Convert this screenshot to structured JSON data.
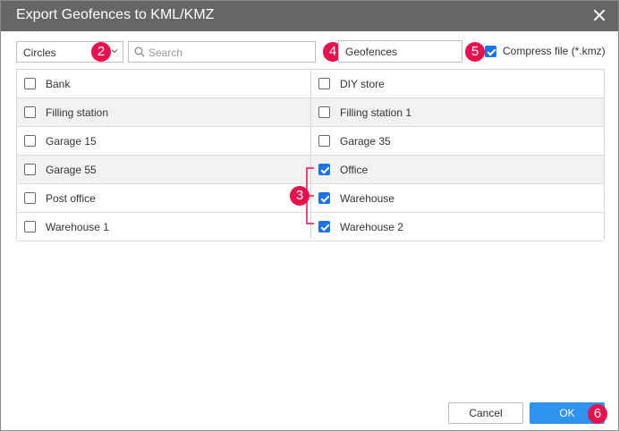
{
  "window": {
    "title": "Export Geofences to KML/KMZ"
  },
  "toolbar": {
    "type_select_value": "Circles",
    "search_placeholder": "Search",
    "filename_value": "Geofences",
    "compress_label": "Compress file (*.kmz)",
    "compress_checked": true
  },
  "geofences": {
    "left": [
      {
        "label": "Bank",
        "checked": false
      },
      {
        "label": "Filling station",
        "checked": false
      },
      {
        "label": "Garage 15",
        "checked": false
      },
      {
        "label": "Garage 55",
        "checked": false
      },
      {
        "label": "Post office",
        "checked": false
      },
      {
        "label": "Warehouse 1",
        "checked": false
      }
    ],
    "right": [
      {
        "label": "DIY store",
        "checked": false
      },
      {
        "label": "Filling station 1",
        "checked": false
      },
      {
        "label": "Garage 35",
        "checked": false
      },
      {
        "label": "Office",
        "checked": true
      },
      {
        "label": "Warehouse",
        "checked": true
      },
      {
        "label": "Warehouse 2",
        "checked": true
      }
    ]
  },
  "annotations": {
    "b2": "2",
    "b3": "3",
    "b4": "4",
    "b5": "5",
    "b6": "6"
  },
  "footer": {
    "cancel_label": "Cancel",
    "ok_label": "OK"
  },
  "colors": {
    "titlebar": "#666666",
    "accent": "#2d93ef",
    "badge": "#e8114e",
    "checkbox": "#1a73e8"
  },
  "icons": {
    "close": "close-icon",
    "chevron": "chevron-down-icon",
    "search": "search-icon"
  }
}
